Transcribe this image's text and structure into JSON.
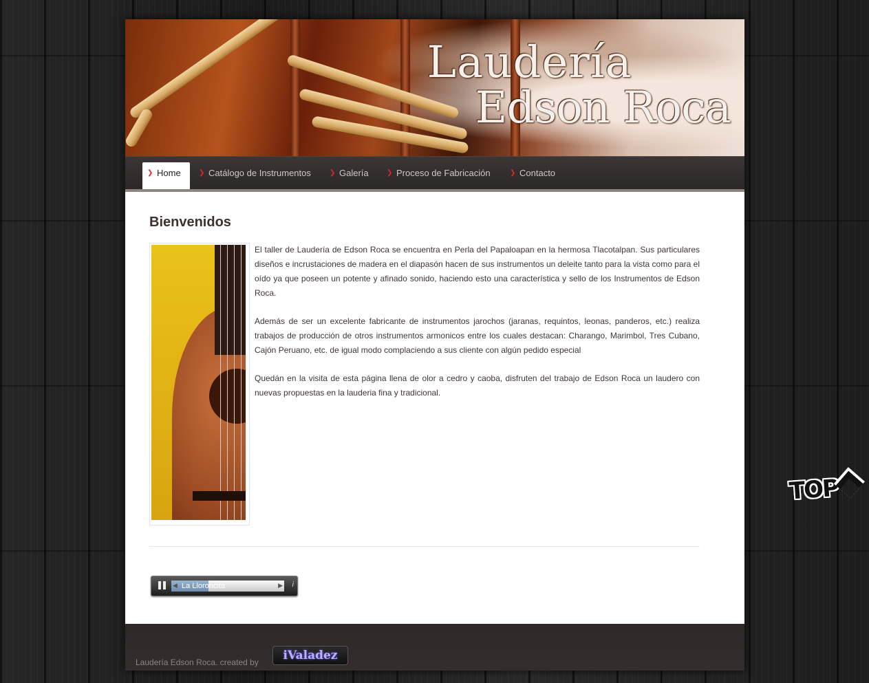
{
  "header": {
    "logo_line1": "Laudería",
    "logo_line2": "Edson Roca"
  },
  "nav": {
    "items": [
      {
        "label": "Home",
        "active": true
      },
      {
        "label": "Catálogo de Instrumentos"
      },
      {
        "label": "Galería"
      },
      {
        "label": "Proceso de Fabricación"
      },
      {
        "label": "Contacto"
      }
    ]
  },
  "main": {
    "title": "Bienvenidos",
    "paragraphs": [
      "El taller de Laudería de Edson Roca se encuentra en Perla del Papaloapan en la hermosa Tlacotalpan. Sus particulares diseños e incrustaciones de madera en el diapasón hacen de sus instrumentos un deleite tanto para la vista como para el oído ya que poseen un potente y afinado sonido, haciendo esto una característica y sello de los Instrumentos de Edson Roca.",
      "Además de ser un excelente fabricante de instrumentos jarochos (jaranas, requintos, leonas, panderos, etc.) realiza trabajos de producción de otros instrumentos armonicos entre los cuales destacan: Charango, Marimbol, Tres Cubano, Cajón Peruano, etc. de igual modo complaciendo a sus cliente con algún pedido especial",
      "Quedán en la visita de esta página llena de olor a cedro y caoba, disfruten del trabajo de Edson Roca un laudero con nuevas propuestas en la lauderia fina y tradicional."
    ]
  },
  "player": {
    "track_title": "La Lloroncita",
    "progress": 0.33,
    "info_label": "i"
  },
  "footer": {
    "credit": "Laudería Edson Roca. created by",
    "badge": "iValadez"
  },
  "top_button": {
    "label": "TOP"
  }
}
